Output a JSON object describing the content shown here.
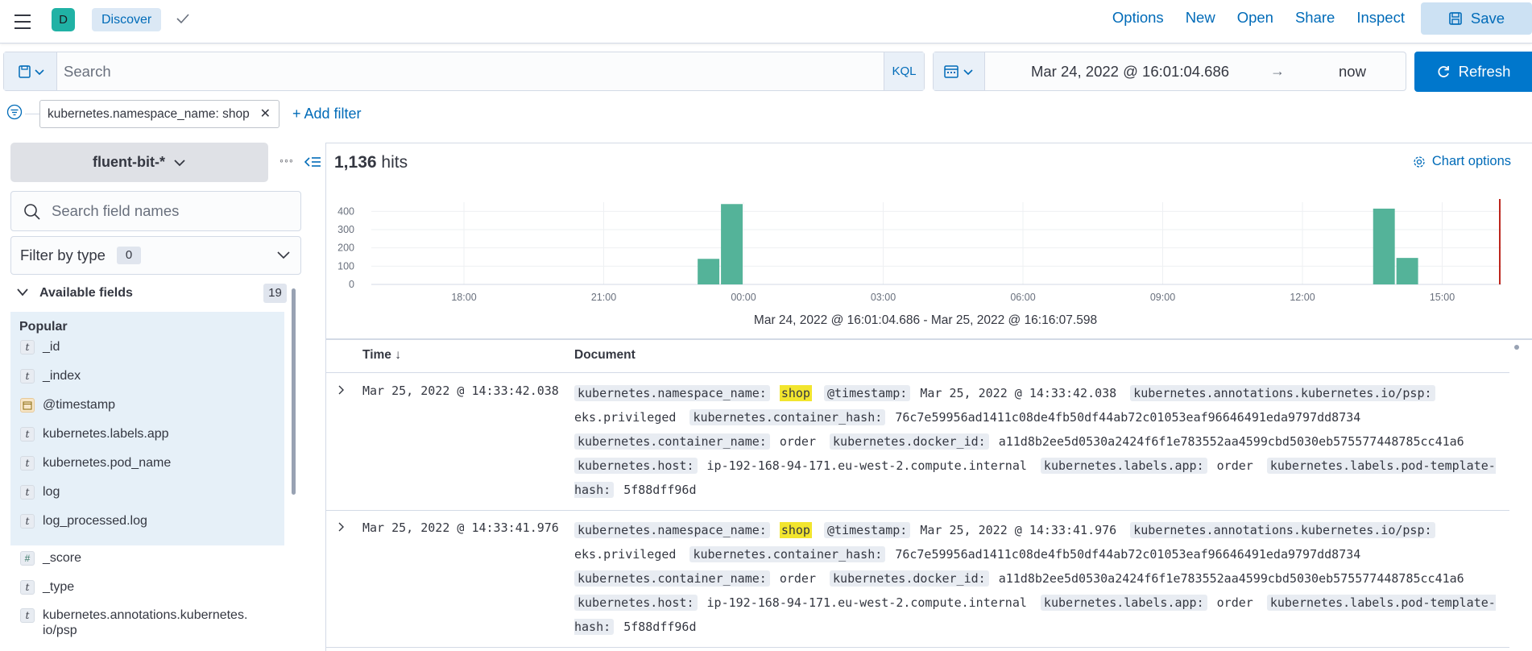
{
  "header": {
    "space_initial": "D",
    "app_name": "Discover",
    "links": [
      "Options",
      "New",
      "Open",
      "Share",
      "Inspect"
    ],
    "save_label": "Save"
  },
  "query": {
    "search_placeholder": "Search",
    "language": "KQL",
    "start": "Mar 24, 2022 @ 16:01:04.686",
    "arrow": "→",
    "end": "now",
    "refresh_label": "Refresh"
  },
  "filters": {
    "pill": "kubernetes.namespace_name: shop",
    "close": "✕",
    "add_label": "+ Add filter"
  },
  "sidebar": {
    "index_pattern": "fluent-bit-*",
    "more": "◦◦◦",
    "search_placeholder": "Search field names",
    "filter_type_label": "Filter by type",
    "filter_type_count": "0",
    "available_label": "Available fields",
    "available_count": "19",
    "popular_label": "Popular",
    "popular_fields": [
      {
        "type": "t",
        "name": "_id"
      },
      {
        "type": "t",
        "name": "_index"
      },
      {
        "type": "date",
        "name": "@timestamp"
      },
      {
        "type": "t",
        "name": "kubernetes.labels.app"
      },
      {
        "type": "t",
        "name": "kubernetes.pod_name"
      },
      {
        "type": "t",
        "name": "log"
      },
      {
        "type": "t",
        "name": "log_processed.log"
      }
    ],
    "other_fields": [
      {
        "type": "#",
        "name": "_score"
      },
      {
        "type": "t",
        "name": "_type"
      },
      {
        "type": "t",
        "name": "kubernetes.annotations.kubernetes.",
        "name2": "io/psp"
      }
    ]
  },
  "main": {
    "hits_count": "1,136",
    "hits_label": "hits",
    "chart_options_label": "Chart options",
    "range_label": "Mar 24, 2022 @ 16:01:04.686 - Mar 25, 2022 @ 16:16:07.598",
    "col_time": "Time ↓",
    "col_document": "Document"
  },
  "chart_data": {
    "type": "bar",
    "title": "",
    "xlabel": "",
    "ylabel": "",
    "ylim": [
      0,
      450
    ],
    "y_ticks": [
      "0",
      "100",
      "200",
      "300",
      "400"
    ],
    "x_ticks": [
      "18:00",
      "21:00",
      "00:00",
      "03:00",
      "06:00",
      "09:00",
      "12:00",
      "15:00"
    ],
    "bars": [
      {
        "hour_offset": -0.75,
        "value": 140
      },
      {
        "hour_offset": -0.25,
        "value": 440
      },
      {
        "hour_offset": 13.75,
        "value": 415
      },
      {
        "hour_offset": 14.25,
        "value": 145
      }
    ],
    "bar_color": "#54b399",
    "now_line_color": "#bd271e",
    "grid": true
  },
  "rows": [
    {
      "time": "Mar 25, 2022 @ 14:33:42.038",
      "fields": [
        {
          "k": "kubernetes.namespace_name:",
          "v": "shop",
          "hl": true
        },
        {
          "k": "@timestamp:",
          "v": "Mar 25, 2022 @ 14:33:42.038"
        },
        {
          "k": "kubernetes.annotations.kubernetes.io/psp:",
          "v": "eks.privileged"
        },
        {
          "k": "kubernetes.container_hash:",
          "v": "76c7e59956ad1411c08de4fb50df44ab72c01053eaf96646491eda9797dd8734"
        },
        {
          "k": "kubernetes.container_name:",
          "v": "order"
        },
        {
          "k": "kubernetes.docker_id:",
          "v": "a11d8b2ee5d0530a2424f6f1e783552aa4599cbd5030eb575577448785cc41a6"
        },
        {
          "k": "kubernetes.host:",
          "v": "ip-192-168-94-171.eu-west-2.compute.internal"
        },
        {
          "k": "kubernetes.labels.app:",
          "v": "order"
        },
        {
          "k": "kubernetes.labels.pod-template-hash:",
          "v": "5f88dff96d"
        }
      ]
    },
    {
      "time": "Mar 25, 2022 @ 14:33:41.976",
      "fields": [
        {
          "k": "kubernetes.namespace_name:",
          "v": "shop",
          "hl": true
        },
        {
          "k": "@timestamp:",
          "v": "Mar 25, 2022 @ 14:33:41.976"
        },
        {
          "k": "kubernetes.annotations.kubernetes.io/psp:",
          "v": "eks.privileged"
        },
        {
          "k": "kubernetes.container_hash:",
          "v": "76c7e59956ad1411c08de4fb50df44ab72c01053eaf96646491eda9797dd8734"
        },
        {
          "k": "kubernetes.container_name:",
          "v": "order"
        },
        {
          "k": "kubernetes.docker_id:",
          "v": "a11d8b2ee5d0530a2424f6f1e783552aa4599cbd5030eb575577448785cc41a6"
        },
        {
          "k": "kubernetes.host:",
          "v": "ip-192-168-94-171.eu-west-2.compute.internal"
        },
        {
          "k": "kubernetes.labels.app:",
          "v": "order"
        },
        {
          "k": "kubernetes.labels.pod-template-hash:",
          "v": "5f88dff96d"
        }
      ]
    }
  ],
  "colors": {
    "accent": "#0077cc",
    "link": "#006bb8",
    "highlight": "#f2e52e"
  }
}
